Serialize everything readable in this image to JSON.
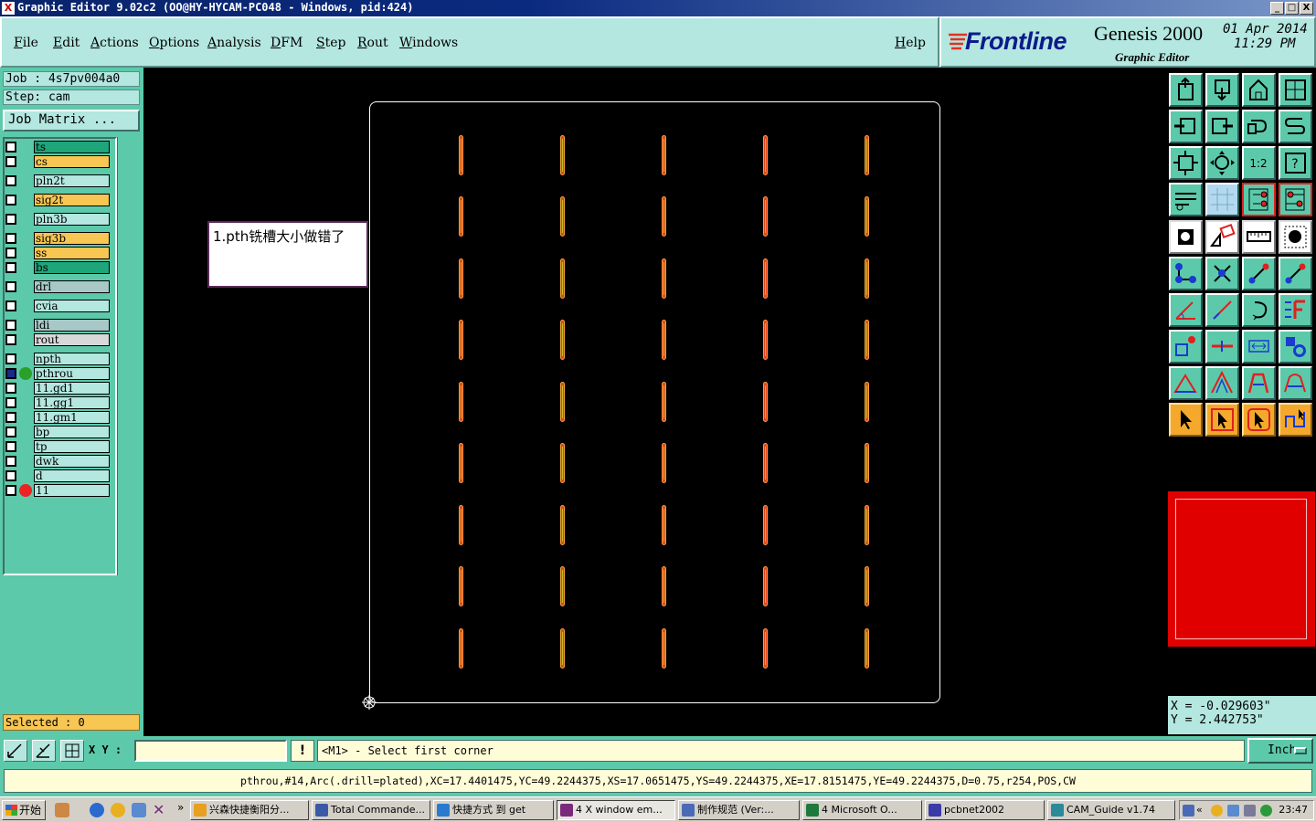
{
  "window": {
    "title": "Graphic Editor 9.02c2 (OO@HY-HYCAM-PC048 - Windows, pid:424)",
    "buttons": [
      "_",
      "□",
      "X"
    ]
  },
  "menu": {
    "items": [
      "File",
      "Edit",
      "Actions",
      "Options",
      "Analysis",
      "DFM",
      "Step",
      "Rout",
      "Windows"
    ],
    "help": "Help"
  },
  "brand": {
    "logo": "Frontline",
    "product": "Genesis 2000",
    "subtitle": "Graphic Editor",
    "date": "01 Apr 2014",
    "time": "11:29 PM"
  },
  "job": {
    "job_line": "Job : 4s7pv004a0",
    "step_line": "Step: cam",
    "matrix_button": "Job Matrix ..."
  },
  "layers": [
    {
      "name": "ts",
      "color": "#1fa57a"
    },
    {
      "name": "cs",
      "color": "#f7c653"
    },
    {
      "name": "pln2t",
      "color": "#b3e7e0"
    },
    {
      "name": "sig2t",
      "color": "#f7c653"
    },
    {
      "name": "pln3b",
      "color": "#b3e7e0"
    },
    {
      "name": "sig3b",
      "color": "#f7c653"
    },
    {
      "name": "ss",
      "color": "#f7c653"
    },
    {
      "name": "bs",
      "color": "#1fa57a"
    },
    {
      "name": "drl",
      "color": "#a8c8c8"
    },
    {
      "name": "cvia",
      "color": "#b3e7e0"
    },
    {
      "name": "ldi",
      "color": "#a8c8c8"
    },
    {
      "name": "rout",
      "color": "#d8d8d8"
    },
    {
      "name": "npth",
      "color": "#b3e7e0"
    },
    {
      "name": "pthrou",
      "color": "#b3e7e0",
      "marker": "green"
    },
    {
      "name": "11.gd1",
      "color": "#b3e7e0"
    },
    {
      "name": "11.gg1",
      "color": "#b3e7e0"
    },
    {
      "name": "11.gm1",
      "color": "#b3e7e0"
    },
    {
      "name": "bp",
      "color": "#b3e7e0"
    },
    {
      "name": "tp",
      "color": "#b3e7e0"
    },
    {
      "name": "dwk",
      "color": "#b3e7e0"
    },
    {
      "name": "d",
      "color": "#b3e7e0"
    },
    {
      "name": "11",
      "color": "#b3e7e0",
      "marker": "red"
    }
  ],
  "selected": "Selected : 0",
  "annotation": "1.pth铣槽大小做错了",
  "coords": {
    "x": "X = -0.029603\"",
    "y": "Y = 2.442753\""
  },
  "command": {
    "xy_label": "X Y :",
    "xy_value": "",
    "warn": "!",
    "prompt": "<M1> - Select first corner",
    "unit": "Inch"
  },
  "feature_info": "pthrou,#14,Arc(.drill=plated),XC=17.4401475,YC=49.2244375,XS=17.0651475,YS=49.2244375,XE=17.8151475,YE=49.2244375,D=0.75,r254,POS,CW",
  "taskbar": {
    "start": "开始",
    "tasks": [
      {
        "label": "兴森快捷衡阳分...",
        "icon_color": "#e8a020"
      },
      {
        "label": "Total Commande...",
        "icon_color": "#3a5aa8"
      },
      {
        "label": "快捷方式 到 get",
        "icon_color": "#2a7ad0"
      },
      {
        "label": "4 X window em...",
        "icon_color": "#7a2a7a",
        "active": true
      },
      {
        "label": "制作规范 (Ver:...",
        "icon_color": "#4a6ab8"
      },
      {
        "label": "4 Microsoft O...",
        "icon_color": "#1e7a3a"
      },
      {
        "label": "pcbnet2002",
        "icon_color": "#3a3aa8"
      },
      {
        "label": "CAM_Guide v1.74",
        "icon_color": "#2a8a9a"
      }
    ],
    "clock": "23:47"
  },
  "icons": {
    "slot_color": "#e0461d",
    "minimap_color": "#e00000",
    "panel_teal": "#5ccaaa",
    "panel_light": "#b3e7e0"
  }
}
